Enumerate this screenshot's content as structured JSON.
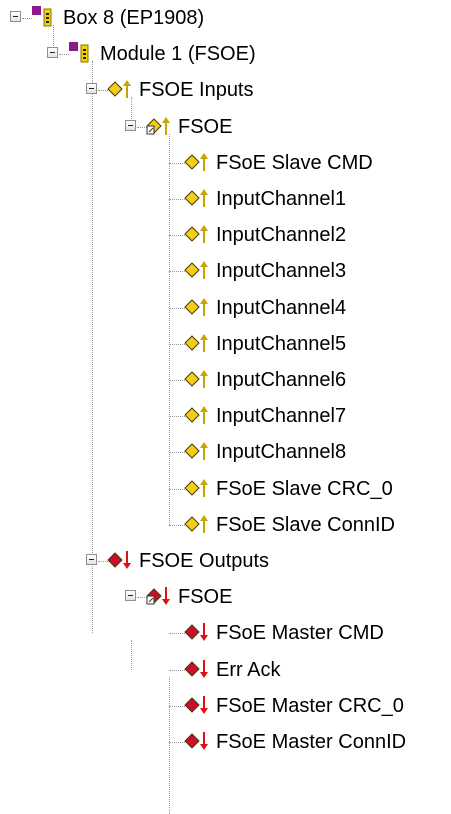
{
  "tree": {
    "box": {
      "label": "Box 8 (EP1908)",
      "icon": "box-device-icon"
    },
    "module": {
      "label": "Module 1 (FSOE)",
      "icon": "module-icon"
    },
    "inputs": {
      "label": "FSOE Inputs",
      "icon": "input-variables-icon",
      "group": {
        "label": "FSOE",
        "icon": "input-group-icon"
      },
      "items": [
        "FSoE Slave CMD",
        "InputChannel1",
        "InputChannel2",
        "InputChannel3",
        "InputChannel4",
        "InputChannel5",
        "InputChannel6",
        "InputChannel7",
        "InputChannel8",
        "FSoE Slave CRC_0",
        "FSoE Slave ConnID"
      ]
    },
    "outputs": {
      "label": "FSOE Outputs",
      "icon": "output-variables-icon",
      "group": {
        "label": "FSOE",
        "icon": "output-group-icon"
      },
      "items": [
        "FSoE Master CMD",
        "Err Ack",
        "FSoE Master CRC_0",
        "FSoE Master ConnID"
      ]
    }
  },
  "colors": {
    "input_arrow": "#c9a400",
    "output_arrow": "#e01010",
    "input_diamond": "#f2cd1a",
    "output_diamond": "#c8102e",
    "box_magenta": "#8b1a8b",
    "box_yellow": "#f2d200",
    "tree_lines": "#9a9a9a"
  }
}
